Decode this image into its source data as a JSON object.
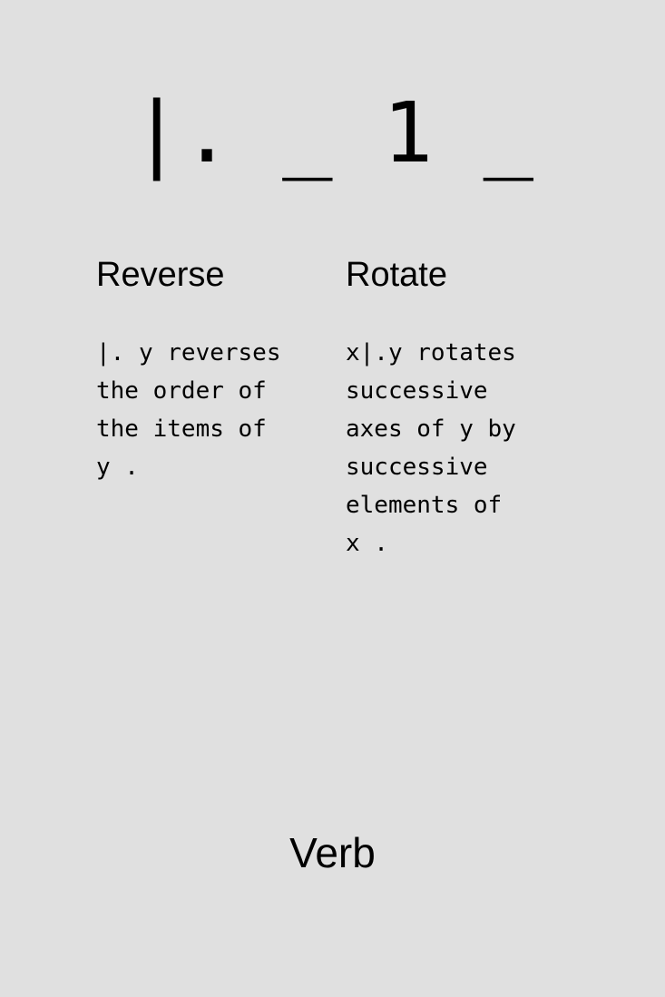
{
  "glyph": "|. _ 1 _",
  "entries": [
    {
      "title": "Reverse",
      "description": "|. y reverses\nthe order of\nthe items of\ny ."
    },
    {
      "title": "Rotate",
      "description": "x|.y rotates\nsuccessive\naxes of y by\nsuccessive\nelements of\nx ."
    }
  ],
  "category": "Verb"
}
